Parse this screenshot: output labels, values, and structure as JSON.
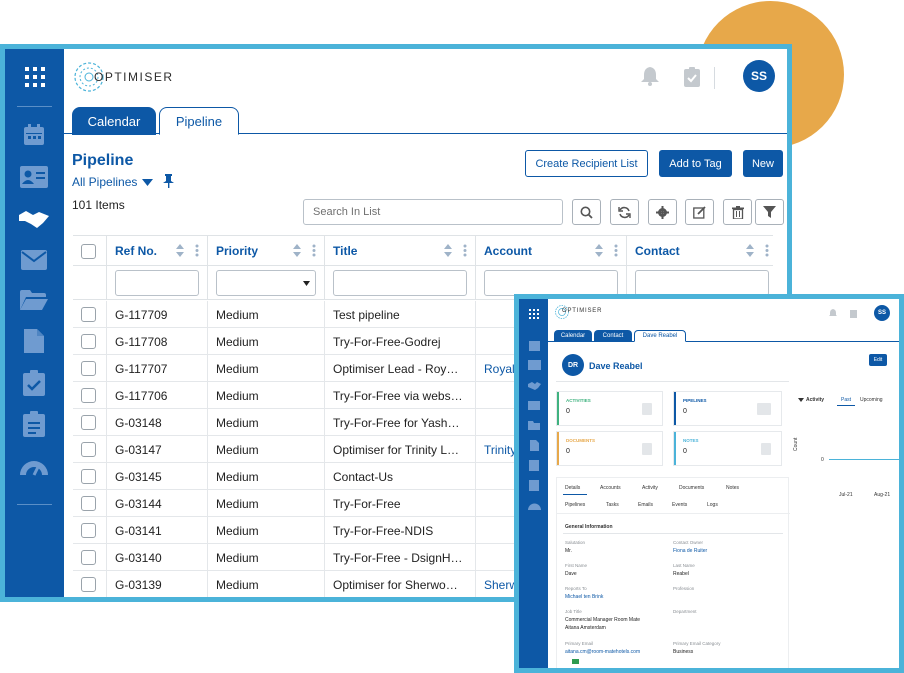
{
  "brand": {
    "logo_text": "OPTIMISER",
    "accent": "#0D58A6",
    "frame": "#4BB3D9",
    "decor": "#E7A84A"
  },
  "header": {
    "user_initials": "SS",
    "icons": [
      "apps-grid-icon",
      "bell-icon",
      "clipboard-check-icon"
    ]
  },
  "tabs": [
    {
      "label": "Calendar",
      "active": true
    },
    {
      "label": "Pipeline",
      "active": false
    }
  ],
  "sidebar_icons": [
    "calendar-icon",
    "contact-card-icon",
    "handshake-icon",
    "mail-icon",
    "folder-icon",
    "document-icon",
    "checklist-icon",
    "clipboard-icon",
    "dashboard-gauge-icon"
  ],
  "page": {
    "title": "Pipeline",
    "view_selector": "All Pipelines",
    "items_count": "101 Items",
    "buttons": {
      "create_recipient_list": "Create Recipient List",
      "add_to_tag": "Add to Tag",
      "new": "New"
    },
    "search_placeholder": "Search In List"
  },
  "table": {
    "columns": [
      "Ref No.",
      "Priority",
      "Title",
      "Account",
      "Contact"
    ],
    "rows": [
      {
        "ref": "G-117709",
        "priority": "Medium",
        "title": "Test pipeline",
        "account": ""
      },
      {
        "ref": "G-117708",
        "priority": "Medium",
        "title": "Try-For-Free-Godrej",
        "account": ""
      },
      {
        "ref": "G-117707",
        "priority": "Medium",
        "title": "Optimiser Lead - Roy…",
        "account": "Royal"
      },
      {
        "ref": "G-117706",
        "priority": "Medium",
        "title": "Try-For-Free via webs…",
        "account": ""
      },
      {
        "ref": "G-03148",
        "priority": "Medium",
        "title": "Try-For-Free for Yash…",
        "account": ""
      },
      {
        "ref": "G-03147",
        "priority": "Medium",
        "title": "Optimiser for Trinity L…",
        "account": "Trinity"
      },
      {
        "ref": "G-03145",
        "priority": "Medium",
        "title": "Contact-Us",
        "account": ""
      },
      {
        "ref": "G-03144",
        "priority": "Medium",
        "title": "Try-For-Free",
        "account": ""
      },
      {
        "ref": "G-03141",
        "priority": "Medium",
        "title": "Try-For-Free-NDIS",
        "account": ""
      },
      {
        "ref": "G-03140",
        "priority": "Medium",
        "title": "Try-For-Free - DsignH…",
        "account": ""
      },
      {
        "ref": "G-03139",
        "priority": "Medium",
        "title": "Optimiser for Sherwo…",
        "account": "Sherw"
      }
    ]
  },
  "detail": {
    "logo_text": "OPTIMISER",
    "user_initials": "SS",
    "tabs": [
      "Calendar",
      "Contact",
      "Dave Reabel"
    ],
    "initials": "DR",
    "name": "Dave Reabel",
    "edit_label": "Edit",
    "cards": [
      {
        "label": "ACTIVITIES",
        "value": "0",
        "color": "#3FB27F"
      },
      {
        "label": "PIPELINES",
        "value": "0",
        "color": "#0D58A6"
      },
      {
        "label": "DOCUMENTS",
        "value": "0",
        "color": "#E7A84A"
      },
      {
        "label": "NOTES",
        "value": "0",
        "color": "#4BB3D9"
      }
    ],
    "activity": {
      "title": "Activity",
      "tab_past": "Past",
      "tab_upcoming": "Upcoming",
      "y_label": "Count",
      "y_tick": "0",
      "x_ticks": [
        "Jul-21",
        "Aug-21"
      ]
    },
    "subtabs_row1": [
      "Details",
      "Accounts",
      "Activity",
      "Documents",
      "Notes"
    ],
    "subtabs_row2": [
      "Pipelines",
      "Tasks",
      "Emails",
      "Events",
      "Logs"
    ],
    "section_title": "General Information",
    "fields": {
      "salutation_label": "Salutation",
      "salutation": "Mr.",
      "owner_label": "Contact Owner",
      "owner": "Fiona de Ruiter",
      "first_name_label": "First Name",
      "first_name": "Dave",
      "last_name_label": "Last Name",
      "last_name": "Reabel",
      "reports_to_label": "Reports To",
      "reports_to": "Michael ten Brink",
      "profession_label": "Profession",
      "job_title_label": "Job Title",
      "job_title_1": "Commercial Manager Room Mate",
      "job_title_2": "Aitana Amsterdam",
      "department_label": "Department",
      "email_label": "Primary Email",
      "email": "aitana.cm@room-matehotels.com",
      "email_category_label": "Primary Email Category",
      "email_category": "Business"
    }
  }
}
